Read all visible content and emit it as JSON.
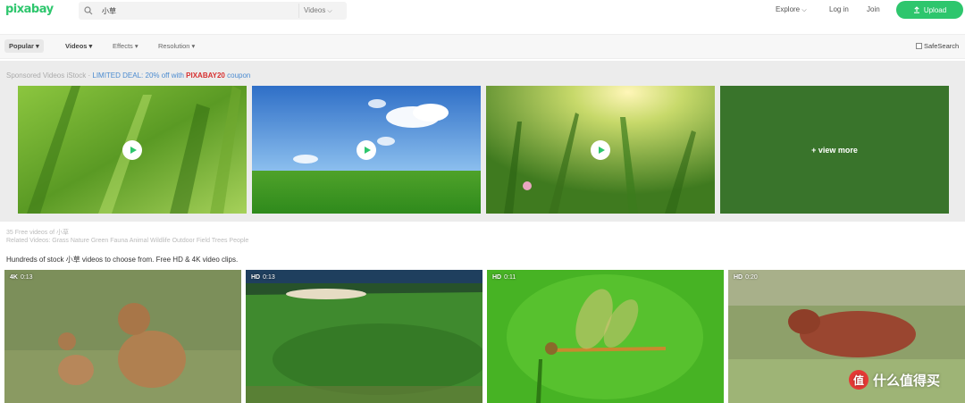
{
  "header": {
    "logo": "pixabay",
    "search": {
      "value": "小草",
      "type_label": "Videos"
    },
    "nav": {
      "explore": "Explore",
      "login": "Log in",
      "join": "Join",
      "upload": "Upload"
    }
  },
  "filters": {
    "popular": "Popular",
    "videos": "Videos",
    "effects": "Effects",
    "resolution": "Resolution",
    "safesearch": "SafeSearch"
  },
  "sponsored": {
    "prefix": "Sponsored Videos iStock ·",
    "deal": " LIMITED DEAL: 20% off with ",
    "code": "PIXABAY20",
    "suffix": " coupon",
    "view_more": "+ view more"
  },
  "results": {
    "count_text": "35 Free videos of 小草",
    "related_label": "Related Videos:",
    "related_tags": [
      "Grass",
      "Nature",
      "Green",
      "Fauna",
      "Animal",
      "Wildlife",
      "Outdoor",
      "Field",
      "Trees",
      "People"
    ],
    "description": "Hundreds of stock 小草 videos to choose from. Free HD & 4K video clips.",
    "videos": [
      {
        "quality": "4K",
        "duration": "0:13"
      },
      {
        "quality": "HD",
        "duration": "0:13"
      },
      {
        "quality": "HD",
        "duration": "0:11"
      },
      {
        "quality": "HD",
        "duration": "0:20"
      }
    ]
  },
  "watermark": {
    "text": "什么值得买",
    "logo": "值"
  },
  "colors": {
    "accent": "#2ec66d",
    "deal": "#4b8bd0",
    "code": "#d62f2f"
  }
}
